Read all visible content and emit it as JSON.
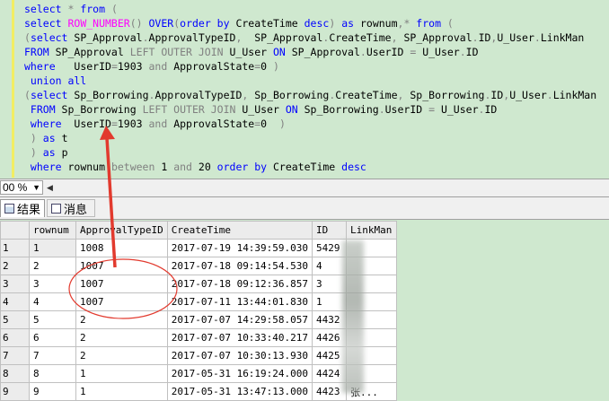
{
  "editor": {
    "lines": [
      [
        {
          "t": "select",
          "c": "kw"
        },
        {
          "t": " * ",
          "c": "gr"
        },
        {
          "t": "from",
          "c": "kw"
        },
        {
          "t": " (",
          "c": "gr"
        }
      ],
      [
        {
          "t": "select ",
          "c": "kw"
        },
        {
          "t": "ROW_NUMBER",
          "c": "fn"
        },
        {
          "t": "() ",
          "c": "gr"
        },
        {
          "t": "OVER",
          "c": "kw"
        },
        {
          "t": "(",
          "c": "gr"
        },
        {
          "t": "order by ",
          "c": "kw"
        },
        {
          "t": "CreateTime ",
          "c": ""
        },
        {
          "t": "desc",
          "c": "kw"
        },
        {
          "t": ") ",
          "c": "gr"
        },
        {
          "t": "as ",
          "c": "kw"
        },
        {
          "t": "rownum",
          "c": ""
        },
        {
          "t": ",* ",
          "c": "gr"
        },
        {
          "t": "from",
          "c": "kw"
        },
        {
          "t": " (",
          "c": "gr"
        }
      ],
      [
        {
          "t": "(",
          "c": "gr"
        },
        {
          "t": "select ",
          "c": "kw"
        },
        {
          "t": "SP_Approval",
          "c": ""
        },
        {
          "t": ".",
          "c": "gr"
        },
        {
          "t": "ApprovalTypeID",
          "c": ""
        },
        {
          "t": ",  ",
          "c": "gr"
        },
        {
          "t": "SP_Approval",
          "c": ""
        },
        {
          "t": ".",
          "c": "gr"
        },
        {
          "t": "CreateTime",
          "c": ""
        },
        {
          "t": ", ",
          "c": "gr"
        },
        {
          "t": "SP_Approval",
          "c": ""
        },
        {
          "t": ".",
          "c": "gr"
        },
        {
          "t": "ID",
          "c": ""
        },
        {
          "t": ",",
          "c": "gr"
        },
        {
          "t": "U_User",
          "c": ""
        },
        {
          "t": ".",
          "c": "gr"
        },
        {
          "t": "LinkMan",
          "c": ""
        }
      ],
      [
        {
          "t": "FROM ",
          "c": "kw"
        },
        {
          "t": "SP_Approval ",
          "c": ""
        },
        {
          "t": "LEFT OUTER JOIN ",
          "c": "gr"
        },
        {
          "t": "U_User ",
          "c": ""
        },
        {
          "t": "ON ",
          "c": "kw"
        },
        {
          "t": "SP_Approval",
          "c": ""
        },
        {
          "t": ".",
          "c": "gr"
        },
        {
          "t": "UserID ",
          "c": ""
        },
        {
          "t": "= ",
          "c": "gr"
        },
        {
          "t": "U_User",
          "c": ""
        },
        {
          "t": ".",
          "c": "gr"
        },
        {
          "t": "ID",
          "c": ""
        }
      ],
      [
        {
          "t": "where   ",
          "c": "kw"
        },
        {
          "t": "UserID",
          "c": ""
        },
        {
          "t": "=",
          "c": "gr"
        },
        {
          "t": "1903 ",
          "c": ""
        },
        {
          "t": "and ",
          "c": "gr"
        },
        {
          "t": "ApprovalState",
          "c": ""
        },
        {
          "t": "=",
          "c": "gr"
        },
        {
          "t": "0 ",
          "c": ""
        },
        {
          "t": ")",
          "c": "gr"
        }
      ],
      [
        {
          "t": " union all",
          "c": "kw"
        }
      ],
      [
        {
          "t": "(",
          "c": "gr"
        },
        {
          "t": "select ",
          "c": "kw"
        },
        {
          "t": "Sp_Borrowing",
          "c": ""
        },
        {
          "t": ".",
          "c": "gr"
        },
        {
          "t": "ApprovalTypeID",
          "c": ""
        },
        {
          "t": ", ",
          "c": "gr"
        },
        {
          "t": "Sp_Borrowing",
          "c": ""
        },
        {
          "t": ".",
          "c": "gr"
        },
        {
          "t": "CreateTime",
          "c": ""
        },
        {
          "t": ", ",
          "c": "gr"
        },
        {
          "t": "Sp_Borrowing",
          "c": ""
        },
        {
          "t": ".",
          "c": "gr"
        },
        {
          "t": "ID",
          "c": ""
        },
        {
          "t": ",",
          "c": "gr"
        },
        {
          "t": "U_User",
          "c": ""
        },
        {
          "t": ".",
          "c": "gr"
        },
        {
          "t": "LinkMan",
          "c": ""
        }
      ],
      [
        {
          "t": " FROM ",
          "c": "kw"
        },
        {
          "t": "Sp_Borrowing ",
          "c": ""
        },
        {
          "t": "LEFT OUTER JOIN ",
          "c": "gr"
        },
        {
          "t": "U_User ",
          "c": ""
        },
        {
          "t": "ON ",
          "c": "kw"
        },
        {
          "t": "Sp_Borrowing",
          "c": ""
        },
        {
          "t": ".",
          "c": "gr"
        },
        {
          "t": "UserID ",
          "c": ""
        },
        {
          "t": "= ",
          "c": "gr"
        },
        {
          "t": "U_User",
          "c": ""
        },
        {
          "t": ".",
          "c": "gr"
        },
        {
          "t": "ID",
          "c": ""
        }
      ],
      [
        {
          "t": " where  ",
          "c": "kw"
        },
        {
          "t": "UserID",
          "c": ""
        },
        {
          "t": "=",
          "c": "gr"
        },
        {
          "t": "1903 ",
          "c": ""
        },
        {
          "t": "and ",
          "c": "gr"
        },
        {
          "t": "ApprovalState",
          "c": ""
        },
        {
          "t": "=",
          "c": "gr"
        },
        {
          "t": "0  ",
          "c": ""
        },
        {
          "t": ")",
          "c": "gr"
        }
      ],
      [
        {
          "t": " ) ",
          "c": "gr"
        },
        {
          "t": "as ",
          "c": "kw"
        },
        {
          "t": "t",
          "c": ""
        }
      ],
      [
        {
          "t": " ) ",
          "c": "gr"
        },
        {
          "t": "as ",
          "c": "kw"
        },
        {
          "t": "p",
          "c": ""
        }
      ],
      [
        {
          "t": " where ",
          "c": "kw"
        },
        {
          "t": "rownum ",
          "c": ""
        },
        {
          "t": "between ",
          "c": "gr"
        },
        {
          "t": "1 ",
          "c": ""
        },
        {
          "t": "and ",
          "c": "gr"
        },
        {
          "t": "20 ",
          "c": ""
        },
        {
          "t": "order by ",
          "c": "kw"
        },
        {
          "t": "CreateTime ",
          "c": ""
        },
        {
          "t": "desc",
          "c": "kw"
        }
      ]
    ]
  },
  "status": {
    "zoom": "00 %"
  },
  "tabs": {
    "results": "结果",
    "messages": "消息"
  },
  "grid": {
    "columns": [
      "rownum",
      "ApprovalTypeID",
      "CreateTime",
      "ID",
      "LinkMan"
    ],
    "rows": [
      {
        "rh": "1",
        "cells": [
          "1",
          "1008",
          "2017-07-19 14:39:59.030",
          "5429",
          ""
        ]
      },
      {
        "rh": "2",
        "cells": [
          "2",
          "1007",
          "2017-07-18 09:14:54.530",
          "4",
          ""
        ]
      },
      {
        "rh": "3",
        "cells": [
          "3",
          "1007",
          "2017-07-18 09:12:36.857",
          "3",
          ""
        ]
      },
      {
        "rh": "4",
        "cells": [
          "4",
          "1007",
          "2017-07-11 13:44:01.830",
          "1",
          ""
        ]
      },
      {
        "rh": "5",
        "cells": [
          "5",
          "2",
          "2017-07-07 14:29:58.057",
          "4432",
          ""
        ]
      },
      {
        "rh": "6",
        "cells": [
          "6",
          "2",
          "2017-07-07 10:33:40.217",
          "4426",
          ""
        ]
      },
      {
        "rh": "7",
        "cells": [
          "7",
          "2",
          "2017-07-07 10:30:13.930",
          "4425",
          ""
        ]
      },
      {
        "rh": "8",
        "cells": [
          "8",
          "1",
          "2017-05-31 16:19:24.000",
          "4424",
          ""
        ]
      },
      {
        "rh": "9",
        "cells": [
          "9",
          "1",
          "2017-05-31 13:47:13.000",
          "4423",
          "张..."
        ]
      }
    ]
  },
  "colors": {
    "annotation": "#e23a2e",
    "editor_bg": "#cfe8cf"
  }
}
